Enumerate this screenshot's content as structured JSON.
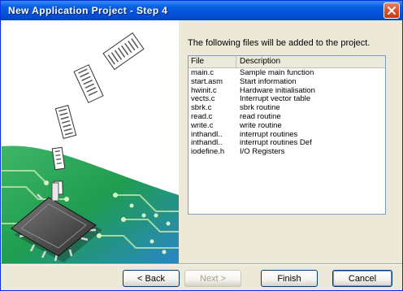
{
  "window": {
    "title": "New Application Project - Step 4"
  },
  "intro_text": "The following files will be added to the project.",
  "file_list": {
    "columns": [
      "File",
      "Description"
    ],
    "rows": [
      {
        "file": "main.c",
        "description": "Sample main function"
      },
      {
        "file": "start.asm",
        "description": "Start information"
      },
      {
        "file": "hwinit.c",
        "description": "Hardware initialisation"
      },
      {
        "file": "vects.c",
        "description": "Interrupt vector table"
      },
      {
        "file": "sbrk.c",
        "description": "sbrk routine"
      },
      {
        "file": "read.c",
        "description": "read routine"
      },
      {
        "file": "write.c",
        "description": "write routine"
      },
      {
        "file": "inthandl..",
        "description": "interrupt routines"
      },
      {
        "file": "inthandl..",
        "description": "interrupt routines Def"
      },
      {
        "file": "iodefine.h",
        "description": "I/O Registers"
      }
    ]
  },
  "buttons": {
    "back": "< Back",
    "next": "Next >",
    "finish": "Finish",
    "cancel": "Cancel"
  },
  "colors": {
    "titlebar": "#0450d8",
    "art_background_green": "#1f9d50",
    "art_background_blue": "#2a86c8",
    "close_button": "#d5522b"
  }
}
